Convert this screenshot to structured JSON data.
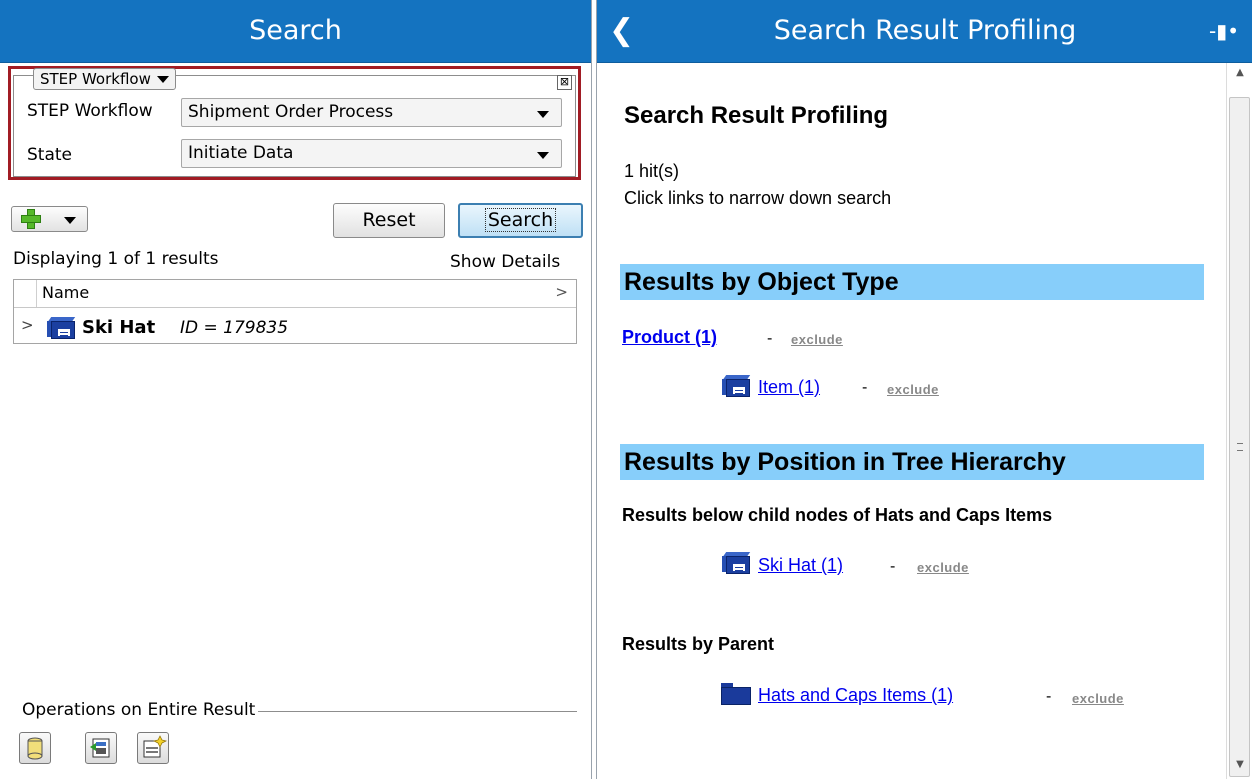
{
  "left_panel": {
    "title": "Search",
    "criteria": {
      "type_selector": "STEP Workflow",
      "close_symbol": "⊠",
      "fields": [
        {
          "label": "STEP Workflow",
          "value": "Shipment Order Process"
        },
        {
          "label": "State",
          "value": "Initiate Data"
        }
      ]
    },
    "toolbar": {
      "reset_label": "Reset",
      "search_label": "Search"
    },
    "results_summary": "Displaying 1 of 1 results",
    "show_details": "Show Details",
    "grid": {
      "column_header": "Name",
      "rows": [
        {
          "name": "Ski Hat",
          "id_text": "ID = 179835"
        }
      ]
    },
    "operations_label": "Operations on Entire Result"
  },
  "right_panel": {
    "title": "Search Result Profiling",
    "heading": "Search Result Profiling",
    "hits": "1 hit(s)",
    "hint": "Click links to narrow down search",
    "section_object_type": "Results by Object Type",
    "product_link": "Product (1)",
    "item_link": "Item (1)",
    "section_tree": "Results by Position in Tree Hierarchy",
    "subsection_child_nodes": "Results below child nodes of Hats and Caps Items",
    "ski_hat_link": "Ski Hat (1)",
    "subsection_parent": "Results by Parent",
    "parent_link": "Hats and Caps Items (1)",
    "exclude_label": "exclude",
    "dash": "-"
  },
  "colors": {
    "titlebar": "#1473c0",
    "highlight_border": "#a11c24",
    "section_band": "#87cefa",
    "link": "#0000ee"
  }
}
